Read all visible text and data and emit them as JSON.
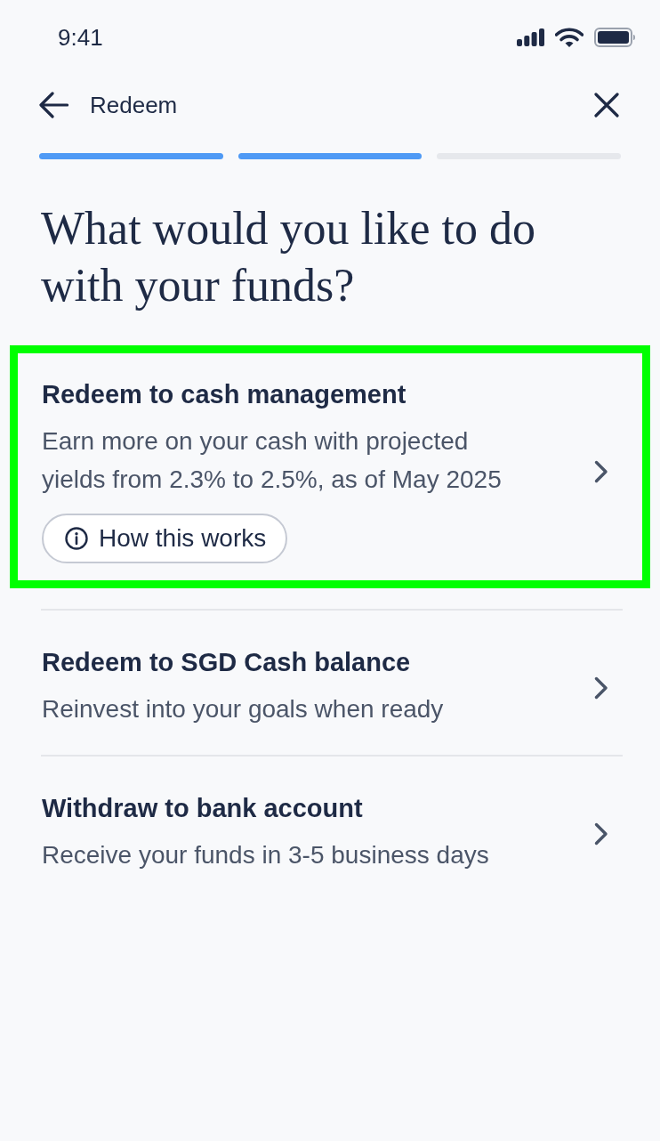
{
  "status_bar": {
    "time": "9:41"
  },
  "nav": {
    "title": "Redeem"
  },
  "progress": {
    "steps": [
      {
        "complete": true
      },
      {
        "complete": true
      },
      {
        "complete": false
      }
    ]
  },
  "heading": "What would you like to do with your funds?",
  "options": [
    {
      "title": "Redeem to cash management",
      "description": "Earn more on your cash with projected yields from 2.3% to 2.5%, as of May 2025",
      "highlighted": true,
      "info_button": {
        "label": "How this works"
      }
    },
    {
      "title": "Redeem to SGD Cash balance",
      "description": "Reinvest into your goals when ready",
      "highlighted": false
    },
    {
      "title": "Withdraw to bank account",
      "description": "Receive your funds in 3-5 business days",
      "highlighted": false
    }
  ]
}
